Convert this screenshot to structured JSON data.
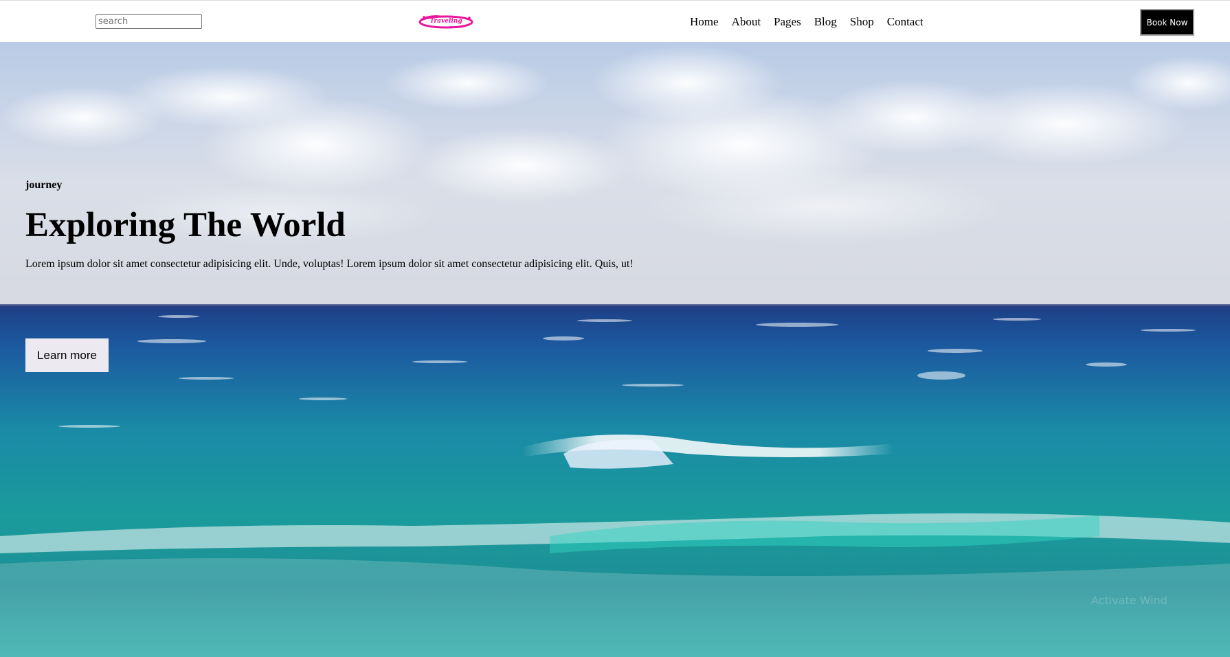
{
  "header": {
    "search": {
      "placeholder": "search",
      "value": ""
    },
    "logo_text": "Traveling",
    "nav": [
      {
        "label": "Home"
      },
      {
        "label": "About"
      },
      {
        "label": "Pages"
      },
      {
        "label": "Blog"
      },
      {
        "label": "Shop"
      },
      {
        "label": "Contact"
      }
    ],
    "book_label": "Book Now"
  },
  "hero": {
    "eyebrow": "journey",
    "title": "Exploring The World",
    "text": "Lorem ipsum dolor sit amet consectetur adipisicing elit. Unde, voluptas! Lorem ipsum dolor sit amet consectetur adipisicing elit. Quis, ut!",
    "button_label": "Learn more",
    "watermark": "Activate Wind"
  },
  "colors": {
    "logo": "#e8169c",
    "book_button_bg": "#000000",
    "learn_more_bg": "#eceaf0",
    "sky": "#c7d3e6",
    "sea": "#1a8ea0"
  }
}
